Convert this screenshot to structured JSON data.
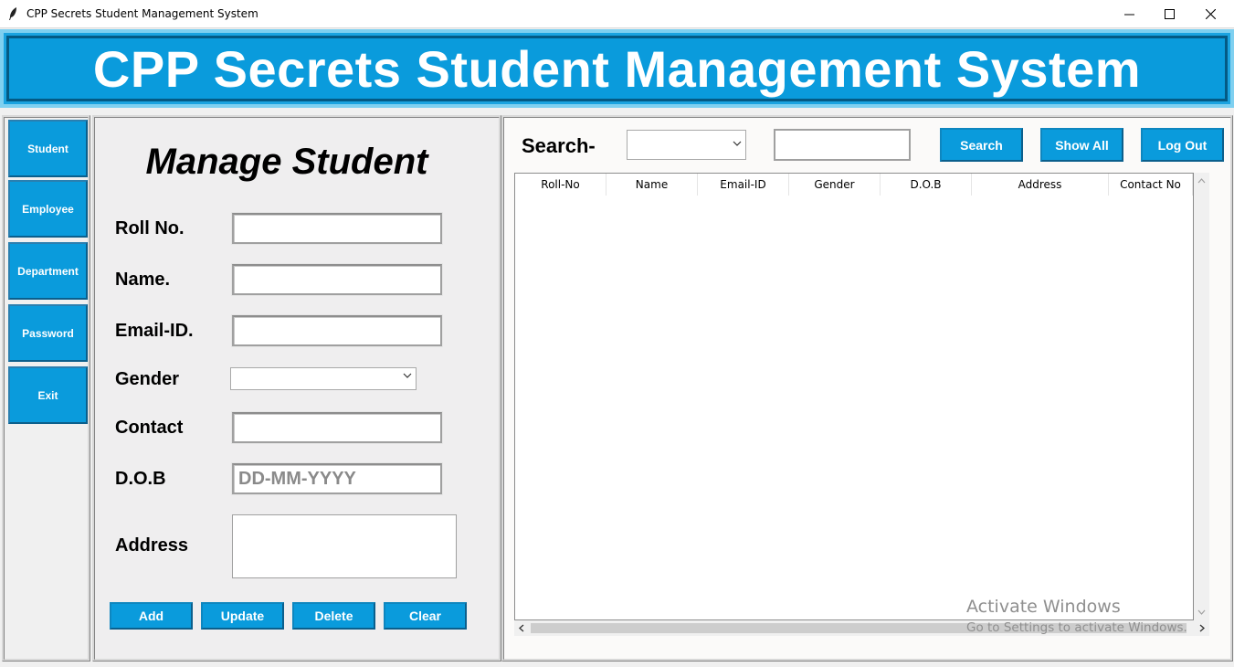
{
  "window": {
    "title": "CPP Secrets Student Management System",
    "icon": "feather-icon",
    "controls": [
      "minimize",
      "maximize",
      "close"
    ]
  },
  "header": {
    "title": "CPP Secrets Student Management System"
  },
  "sidebar": {
    "items": [
      {
        "label": "Student"
      },
      {
        "label": "Employee"
      },
      {
        "label": "Department"
      },
      {
        "label": "Password"
      },
      {
        "label": "Exit"
      }
    ]
  },
  "manage": {
    "title": "Manage Student",
    "fields": {
      "roll": {
        "label": "Roll No.",
        "value": ""
      },
      "name": {
        "label": "Name.",
        "value": ""
      },
      "email": {
        "label": "Email-ID.",
        "value": ""
      },
      "gender": {
        "label": "Gender",
        "value": ""
      },
      "contact": {
        "label": "Contact",
        "value": ""
      },
      "dob": {
        "label": "D.O.B",
        "value": "DD-MM-YYYY"
      },
      "address": {
        "label": "Address",
        "value": ""
      }
    },
    "buttons": {
      "add": "Add",
      "update": "Update",
      "delete": "Delete",
      "clear": "Clear"
    }
  },
  "search": {
    "label": "Search-",
    "by_value": "",
    "text_value": "",
    "search_button": "Search",
    "show_all_button": "Show All",
    "logout_button": "Log Out"
  },
  "table": {
    "columns": [
      "Roll-No",
      "Name",
      "Email-ID",
      "Gender",
      "D.O.B",
      "Address",
      "Contact No"
    ],
    "rows": []
  },
  "watermark": {
    "line1": "Activate Windows",
    "line2": "Go to Settings to activate Windows."
  },
  "colors": {
    "accent": "#0a9bdc",
    "accent_dark": "#045a84",
    "panel_bg": "#efeeef"
  }
}
